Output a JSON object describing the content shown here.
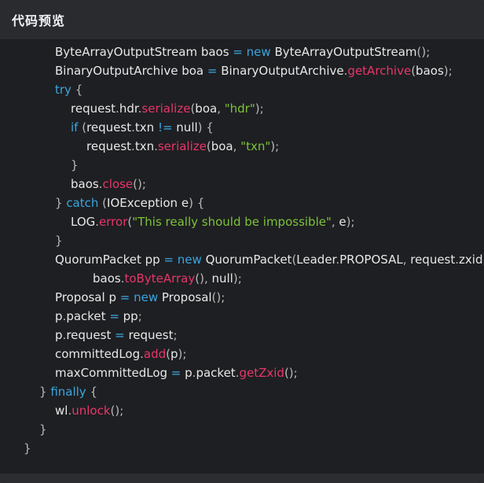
{
  "window": {
    "title": "代码预览"
  },
  "colors": {
    "keyword": "#3aa6e0",
    "function": "#e8366a",
    "string": "#7cc33a",
    "text": "#e8e8e8",
    "background": "#1e1f22",
    "titlebar": "#2a2b2f"
  },
  "code_lines": [
    {
      "indent": 2,
      "tokens": [
        [
          "t",
          "ByteArrayOutputStream baos "
        ],
        [
          "o",
          "="
        ],
        [
          "t",
          " "
        ],
        [
          "k",
          "new"
        ],
        [
          "t",
          " ByteArrayOutputStream"
        ],
        [
          "p",
          "();"
        ]
      ]
    },
    {
      "indent": 2,
      "tokens": [
        [
          "t",
          "BinaryOutputArchive boa "
        ],
        [
          "o",
          "="
        ],
        [
          "t",
          " BinaryOutputArchive"
        ],
        [
          "p",
          "."
        ],
        [
          "f",
          "getArchive"
        ],
        [
          "p",
          "("
        ],
        [
          "t",
          "baos"
        ],
        [
          "p",
          ");"
        ]
      ]
    },
    {
      "indent": 2,
      "tokens": [
        [
          "k",
          "try"
        ],
        [
          "p",
          " {"
        ]
      ]
    },
    {
      "indent": 3,
      "tokens": [
        [
          "t",
          "request"
        ],
        [
          "p",
          "."
        ],
        [
          "t",
          "hdr"
        ],
        [
          "p",
          "."
        ],
        [
          "f",
          "serialize"
        ],
        [
          "p",
          "("
        ],
        [
          "t",
          "boa"
        ],
        [
          "p",
          ", "
        ],
        [
          "s",
          "\"hdr\""
        ],
        [
          "p",
          ");"
        ]
      ]
    },
    {
      "indent": 3,
      "tokens": [
        [
          "k",
          "if"
        ],
        [
          "p",
          " ("
        ],
        [
          "t",
          "request"
        ],
        [
          "p",
          "."
        ],
        [
          "t",
          "txn "
        ],
        [
          "o",
          "!="
        ],
        [
          "t",
          " null"
        ],
        [
          "p",
          ") {"
        ]
      ]
    },
    {
      "indent": 4,
      "tokens": [
        [
          "t",
          "request"
        ],
        [
          "p",
          "."
        ],
        [
          "t",
          "txn"
        ],
        [
          "p",
          "."
        ],
        [
          "f",
          "serialize"
        ],
        [
          "p",
          "("
        ],
        [
          "t",
          "boa"
        ],
        [
          "p",
          ", "
        ],
        [
          "s",
          "\"txn\""
        ],
        [
          "p",
          ");"
        ]
      ]
    },
    {
      "indent": 3,
      "tokens": [
        [
          "p",
          "}"
        ]
      ]
    },
    {
      "indent": 3,
      "tokens": [
        [
          "t",
          "baos"
        ],
        [
          "p",
          "."
        ],
        [
          "f",
          "close"
        ],
        [
          "p",
          "();"
        ]
      ]
    },
    {
      "indent": 2,
      "tokens": [
        [
          "p",
          "} "
        ],
        [
          "k",
          "catch"
        ],
        [
          "p",
          " ("
        ],
        [
          "t",
          "IOException e"
        ],
        [
          "p",
          ") {"
        ]
      ]
    },
    {
      "indent": 3,
      "tokens": [
        [
          "t",
          "LOG"
        ],
        [
          "p",
          "."
        ],
        [
          "f",
          "error"
        ],
        [
          "p",
          "("
        ],
        [
          "s",
          "\"This really should be impossible\""
        ],
        [
          "p",
          ", "
        ],
        [
          "t",
          "e"
        ],
        [
          "p",
          ");"
        ]
      ]
    },
    {
      "indent": 2,
      "tokens": [
        [
          "p",
          "}"
        ]
      ]
    },
    {
      "indent": 2,
      "tokens": [
        [
          "t",
          "QuorumPacket pp "
        ],
        [
          "o",
          "="
        ],
        [
          "t",
          " "
        ],
        [
          "k",
          "new"
        ],
        [
          "t",
          " QuorumPacket"
        ],
        [
          "p",
          "("
        ],
        [
          "t",
          "Leader"
        ],
        [
          "p",
          "."
        ],
        [
          "t",
          "PROPOSAL"
        ],
        [
          "p",
          ", "
        ],
        [
          "t",
          "request"
        ],
        [
          "p",
          "."
        ],
        [
          "t",
          "zxid"
        ],
        [
          "p",
          ","
        ]
      ]
    },
    {
      "indent": 4.4,
      "tokens": [
        [
          "t",
          "baos"
        ],
        [
          "p",
          "."
        ],
        [
          "f",
          "toByteArray"
        ],
        [
          "p",
          "(), "
        ],
        [
          "t",
          "null"
        ],
        [
          "p",
          ");"
        ]
      ]
    },
    {
      "indent": 2,
      "tokens": [
        [
          "t",
          "Proposal p "
        ],
        [
          "o",
          "="
        ],
        [
          "t",
          " "
        ],
        [
          "k",
          "new"
        ],
        [
          "t",
          " Proposal"
        ],
        [
          "p",
          "();"
        ]
      ]
    },
    {
      "indent": 2,
      "tokens": [
        [
          "t",
          "p"
        ],
        [
          "p",
          "."
        ],
        [
          "t",
          "packet "
        ],
        [
          "o",
          "="
        ],
        [
          "t",
          " pp"
        ],
        [
          "p",
          ";"
        ]
      ]
    },
    {
      "indent": 2,
      "tokens": [
        [
          "t",
          "p"
        ],
        [
          "p",
          "."
        ],
        [
          "t",
          "request "
        ],
        [
          "o",
          "="
        ],
        [
          "t",
          " request"
        ],
        [
          "p",
          ";"
        ]
      ]
    },
    {
      "indent": 2,
      "tokens": [
        [
          "t",
          "committedLog"
        ],
        [
          "p",
          "."
        ],
        [
          "f",
          "add"
        ],
        [
          "p",
          "("
        ],
        [
          "t",
          "p"
        ],
        [
          "p",
          ");"
        ]
      ]
    },
    {
      "indent": 2,
      "tokens": [
        [
          "t",
          "maxCommittedLog "
        ],
        [
          "o",
          "="
        ],
        [
          "t",
          " p"
        ],
        [
          "p",
          "."
        ],
        [
          "t",
          "packet"
        ],
        [
          "p",
          "."
        ],
        [
          "f",
          "getZxid"
        ],
        [
          "p",
          "();"
        ]
      ]
    },
    {
      "indent": 1,
      "tokens": [
        [
          "p",
          "} "
        ],
        [
          "k",
          "finally"
        ],
        [
          "p",
          " {"
        ]
      ]
    },
    {
      "indent": 2,
      "tokens": [
        [
          "t",
          "wl"
        ],
        [
          "p",
          "."
        ],
        [
          "f",
          "unlock"
        ],
        [
          "p",
          "();"
        ]
      ]
    },
    {
      "indent": 1,
      "tokens": [
        [
          "p",
          "}"
        ]
      ]
    },
    {
      "indent": 0,
      "tokens": [
        [
          "p",
          "}"
        ]
      ]
    }
  ]
}
